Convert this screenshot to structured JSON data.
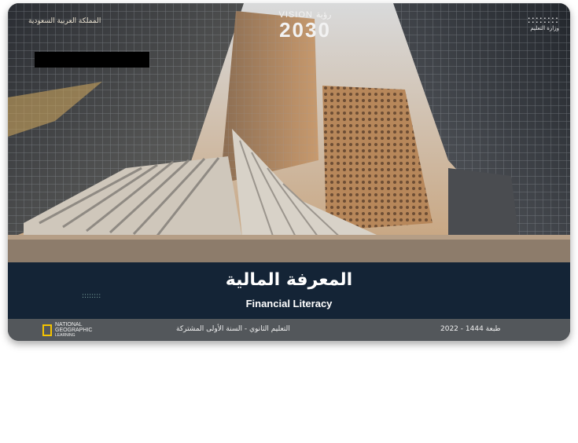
{
  "cover": {
    "kingdom": "المملكة العربية السعودية",
    "vision_label": "VISION رؤية",
    "vision_year": "2030",
    "ministry_name": "وزارة التعليم",
    "ministry_logo_text": "::::::::",
    "title_ar": "المعرفة المالية",
    "title_en": "Financial Literacy",
    "band_logo_text": "::::::::",
    "publisher_line1": "NATIONAL",
    "publisher_line2": "GEOGRAPHIC",
    "publisher_line3": "LEARNING",
    "level": "التعليم الثانوي - السنة الأولى المشتركة",
    "edition": "طبعة 1444 - 2022"
  },
  "colors": {
    "title_band": "#142436",
    "footer": "#53575b",
    "natgeo_yellow": "#f5c400"
  },
  "icons": [
    "ministry-logo-icon",
    "vision-2030-logo",
    "national-geographic-logo"
  ]
}
